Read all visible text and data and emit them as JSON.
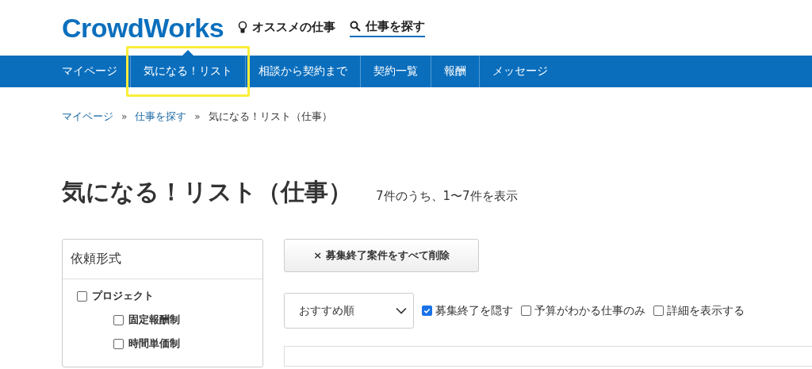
{
  "header": {
    "logo": "CrowdWorks",
    "links": [
      {
        "kind": "recommend",
        "label": "オススメの仕事"
      },
      {
        "kind": "search",
        "label": "仕事を探す"
      }
    ]
  },
  "nav": [
    {
      "label": "マイページ",
      "selected": false,
      "highlighted": false
    },
    {
      "label": "気になる！リスト",
      "selected": true,
      "highlighted": true
    },
    {
      "label": "相談から契約まで",
      "selected": false,
      "highlighted": false
    },
    {
      "label": "契約一覧",
      "selected": false,
      "highlighted": false
    },
    {
      "label": "報酬",
      "selected": false,
      "highlighted": false
    },
    {
      "label": "メッセージ",
      "selected": false,
      "highlighted": false
    }
  ],
  "breadcrumb": [
    {
      "label": "マイページ",
      "link": true
    },
    {
      "label": "仕事を探す",
      "link": true
    },
    {
      "label": "気になる！リスト（仕事）",
      "link": false
    }
  ],
  "breadcrumb_separator": "»",
  "page_title": "気になる！リスト（仕事）",
  "result_count": "7件のうち、1〜7件を表示",
  "sidebar": {
    "title": "依頼形式",
    "options": [
      {
        "label": "プロジェクト",
        "checked": false,
        "children": [
          {
            "label": "固定報酬制",
            "checked": false
          },
          {
            "label": "時間単価制",
            "checked": false
          }
        ]
      }
    ]
  },
  "delete_button": {
    "icon": "×",
    "label": "募集終了案件をすべて削除"
  },
  "sort": {
    "value": "おすすめ順"
  },
  "filters": [
    {
      "label": "募集終了を隠す",
      "checked": true
    },
    {
      "label": "予算がわかる仕事のみ",
      "checked": false
    },
    {
      "label": "詳細を表示する",
      "checked": false
    }
  ]
}
